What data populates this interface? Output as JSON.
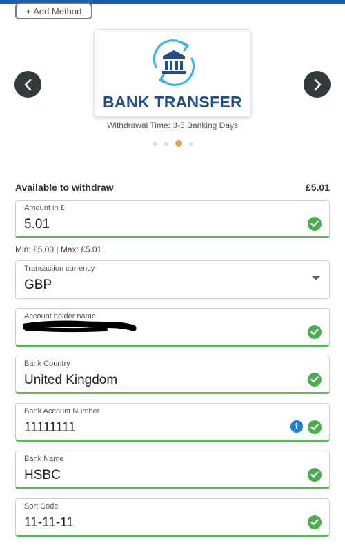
{
  "header": {
    "add_method_label": "+ Add Method"
  },
  "carousel": {
    "card_title": "BANK TRANSFER",
    "card_icon": "bank-transfer-icon",
    "withdrawal_time": "Withdrawal Time: 3-5 Banking Days",
    "dots": 4,
    "active_dot": 2
  },
  "balance": {
    "label": "Available to withdraw",
    "value": "£5.01"
  },
  "amount": {
    "label": "Amount in £",
    "value": "5.01",
    "limits": "Min: £5.00 | Max: £5.01"
  },
  "currency": {
    "label": "Transaction currency",
    "value": "GBP"
  },
  "account_holder": {
    "label": "Account holder name"
  },
  "bank_country": {
    "label": "Bank Country",
    "value": "United Kingdom"
  },
  "account_number": {
    "label": "Bank Account Number",
    "value": "11111111"
  },
  "bank_name": {
    "label": "Bank Name",
    "value": "HSBC"
  },
  "sort_code": {
    "label": "Sort Code",
    "value": "11-11-11"
  },
  "colors": {
    "accent_blue": "#1f5ea8",
    "valid_green": "#4cad50",
    "active_dot": "#d8a84a",
    "nav_button": "#333a3c"
  }
}
